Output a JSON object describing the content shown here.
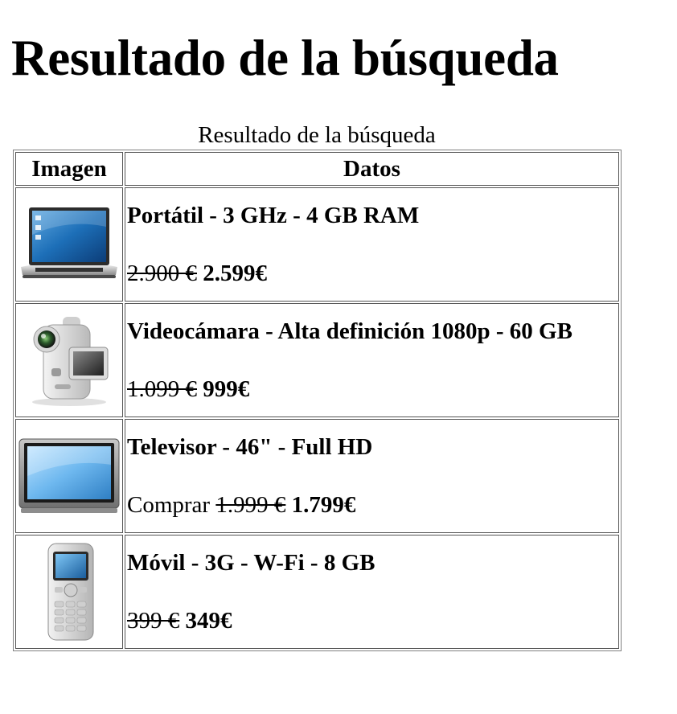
{
  "page": {
    "heading": "Resultado de la búsqueda",
    "table_caption": "Resultado de la búsqueda"
  },
  "table": {
    "headers": [
      "Imagen",
      "Datos"
    ],
    "rows": [
      {
        "icon": "laptop-icon",
        "title": "Portátil - 3 GHz - 4 GB RAM",
        "prefix": "",
        "old_price": "2.900 €",
        "new_price": "2.599€"
      },
      {
        "icon": "camcorder-icon",
        "title": "Videocámara - Alta definición 1080p - 60 GB",
        "prefix": "",
        "old_price": "1.099 €",
        "new_price": "999€"
      },
      {
        "icon": "television-icon",
        "title": "Televisor - 46\" - Full HD",
        "prefix": "Comprar",
        "old_price": "1.999 €",
        "new_price": "1.799€"
      },
      {
        "icon": "mobile-phone-icon",
        "title": "Móvil - 3G - W-Fi - 8 GB",
        "prefix": "",
        "old_price": "399 €",
        "new_price": "349€"
      }
    ]
  }
}
